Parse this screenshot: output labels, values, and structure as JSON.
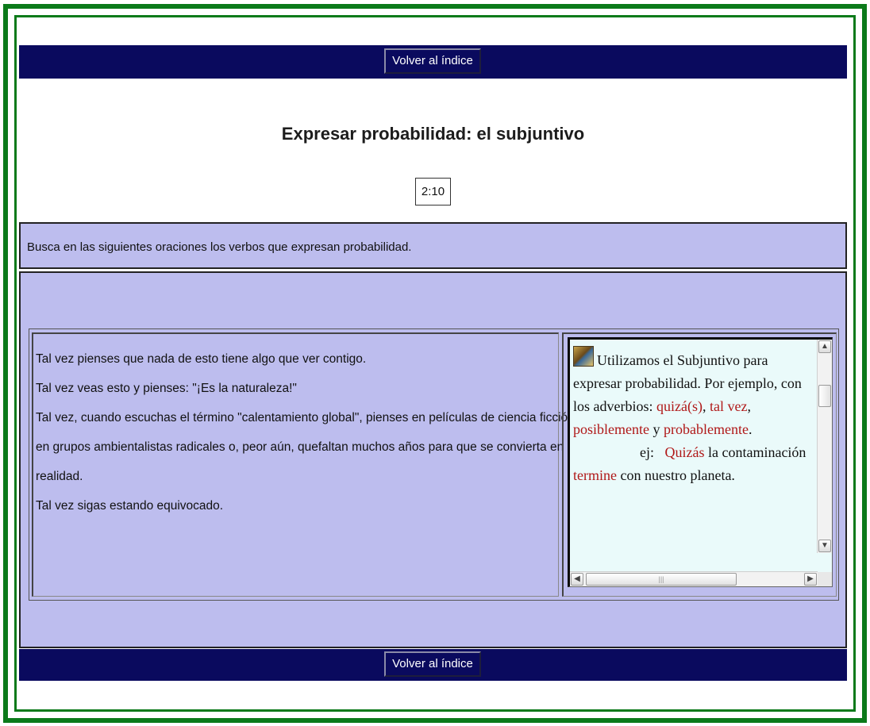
{
  "nav": {
    "back_label": "Volver al índice"
  },
  "title": "Expresar probabilidad: el subjuntivo",
  "timer": "2:10",
  "instruction": "Busca en las siguientes oraciones los verbos que expresan probabilidad.",
  "sentences": [
    "Tal vez pienses que nada de esto tiene algo que ver contigo.",
    "Tal vez veas esto y pienses: \"¡Es la naturaleza!\"",
    "Tal vez, cuando escuchas el término \"calentamiento global\", pienses en películas de ciencia ficción,",
    "en grupos ambientalistas radicales o, peor aún, quefaltan muchos años para que se convierta en",
    "realidad.",
    "Tal vez sigas estando equivocado."
  ],
  "explanation": {
    "intro": "Utilizamos el Subjuntivo para expresar probabilidad. Por ejemplo, con los adverbios: ",
    "adverb1": "quizá(s)",
    "sep1": ", ",
    "adverb2": "tal vez",
    "sep2": ", ",
    "adverb3": "posiblemente",
    "conj": " y ",
    "adverb4": "probablemente",
    "period": ".",
    "example_label": "ej:",
    "example_word1": "Quizás",
    "example_mid": " la contaminación ",
    "example_word2": "termine",
    "example_end": " con nuestro planeta."
  },
  "icons": {
    "scroll_up": "scroll-up-arrow",
    "scroll_down": "scroll-down-arrow",
    "scroll_left": "scroll-left-arrow",
    "scroll_right": "scroll-right-arrow"
  },
  "colors": {
    "frame": "#0b7a1a",
    "nav_bg": "#0a0a5e",
    "panel_bg": "#bdbdee",
    "highlight": "#b01818"
  }
}
